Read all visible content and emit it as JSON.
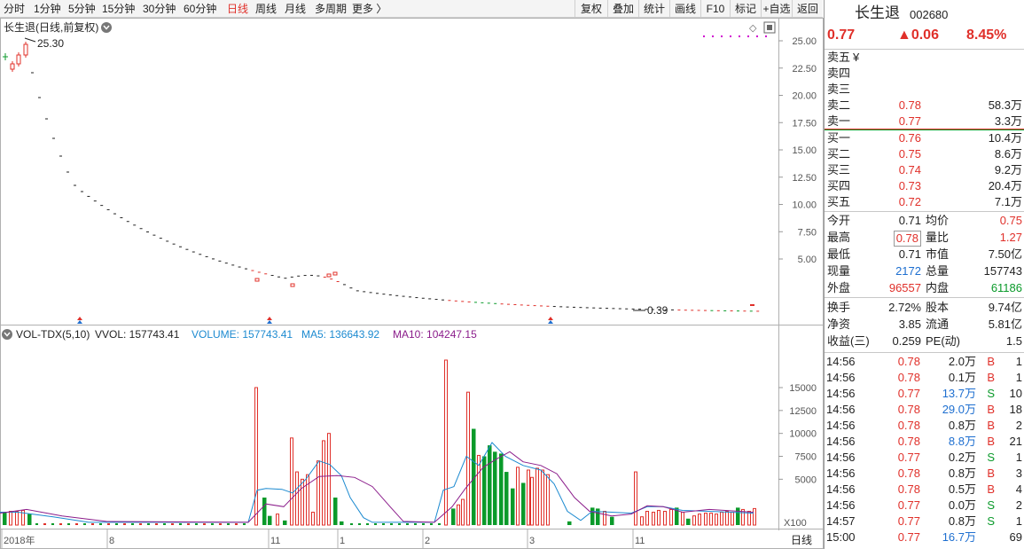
{
  "toolbar": {
    "periods": [
      {
        "label": "分时",
        "active": false
      },
      {
        "label": "1分钟",
        "active": false
      },
      {
        "label": "5分钟",
        "active": false
      },
      {
        "label": "15分钟",
        "active": false
      },
      {
        "label": "30分钟",
        "active": false
      },
      {
        "label": "60分钟",
        "active": false
      },
      {
        "label": "日线",
        "active": true
      },
      {
        "label": "周线",
        "active": false
      },
      {
        "label": "月线",
        "active": false
      },
      {
        "label": "多周期",
        "active": false
      },
      {
        "label": "更多 〉",
        "active": false
      }
    ],
    "tools": [
      "复权",
      "叠加",
      "统计",
      "画线",
      "F10",
      "标记",
      "+自选",
      "返回"
    ]
  },
  "price_chart": {
    "title": "长生退(日线,前复权)",
    "high_label": "25.30",
    "low_label": "0.39",
    "y_ticks": [
      "25.00",
      "22.50",
      "20.00",
      "17.50",
      "15.00",
      "12.50",
      "10.00",
      "7.50",
      "5.00"
    ]
  },
  "volume_chart": {
    "label_prefix": "VOL-TDX(5,10)",
    "vvol": "VVOL: 157743.41",
    "volume": "VOLUME: 157743.41",
    "ma5": "MA5: 136643.92",
    "ma10": "MA10: 104247.15",
    "y_ticks": [
      "15000",
      "12500",
      "10000",
      "7500",
      "5000"
    ],
    "unit": "X100"
  },
  "time_axis": {
    "labels": [
      "2018年",
      "8",
      "11",
      "1",
      "2",
      "3",
      "11"
    ],
    "period_label": "日线"
  },
  "colors": {
    "up": "#e0302a",
    "down": "#0a9a2a",
    "ma5": "#1c8ad0",
    "ma10": "#8b1d8b",
    "accent_pink": "#d000d0"
  },
  "quote": {
    "name": "长生退",
    "code": "002680",
    "price": "0.77",
    "change": "▲0.06",
    "change_pct": "8.45%",
    "asks": [
      {
        "label": "卖五",
        "price": "¥",
        "vol": ""
      },
      {
        "label": "卖四",
        "price": "",
        "vol": ""
      },
      {
        "label": "卖三",
        "price": "",
        "vol": ""
      },
      {
        "label": "卖二",
        "price": "0.78",
        "vol": "58.3万"
      },
      {
        "label": "卖一",
        "price": "0.77",
        "vol": "3.3万"
      }
    ],
    "bids": [
      {
        "label": "买一",
        "price": "0.76",
        "vol": "10.4万"
      },
      {
        "label": "买二",
        "price": "0.75",
        "vol": "8.6万"
      },
      {
        "label": "买三",
        "price": "0.74",
        "vol": "9.2万"
      },
      {
        "label": "买四",
        "price": "0.73",
        "vol": "20.4万"
      },
      {
        "label": "买五",
        "price": "0.72",
        "vol": "7.1万"
      }
    ],
    "stats": [
      {
        "l1": "今开",
        "v1": "0.71",
        "c1": "black",
        "l2": "均价",
        "v2": "0.75",
        "c2": "red"
      },
      {
        "l1": "最高",
        "v1": "0.78",
        "c1": "red",
        "l2": "量比",
        "v2": "1.27",
        "c2": "red"
      },
      {
        "l1": "最低",
        "v1": "0.71",
        "c1": "black",
        "l2": "市值",
        "v2": "7.50亿",
        "c2": "black"
      },
      {
        "l1": "现量",
        "v1": "2172",
        "c1": "blue",
        "l2": "总量",
        "v2": "157743",
        "c2": "black"
      },
      {
        "l1": "外盘",
        "v1": "96557",
        "c1": "red",
        "l2": "内盘",
        "v2": "61186",
        "c2": "green"
      }
    ],
    "stats2": [
      {
        "l1": "换手",
        "v1": "2.72%",
        "l2": "股本",
        "v2": "9.74亿"
      },
      {
        "l1": "净资",
        "v1": "3.85",
        "l2": "流通",
        "v2": "5.81亿"
      },
      {
        "l1": "收益(三)",
        "v1": "0.259",
        "l2": "PE(动)",
        "v2": "1.5"
      }
    ],
    "ticks": [
      {
        "t": "14:56",
        "p": "0.78",
        "v": "2.0万",
        "vc": "black",
        "bs": "B",
        "n": "1"
      },
      {
        "t": "14:56",
        "p": "0.78",
        "v": "0.1万",
        "vc": "black",
        "bs": "B",
        "n": "1"
      },
      {
        "t": "14:56",
        "p": "0.77",
        "v": "13.7万",
        "vc": "blue",
        "bs": "S",
        "n": "10"
      },
      {
        "t": "14:56",
        "p": "0.78",
        "v": "29.0万",
        "vc": "blue",
        "bs": "B",
        "n": "18"
      },
      {
        "t": "14:56",
        "p": "0.78",
        "v": "0.8万",
        "vc": "black",
        "bs": "B",
        "n": "2"
      },
      {
        "t": "14:56",
        "p": "0.78",
        "v": "8.8万",
        "vc": "blue",
        "bs": "B",
        "n": "21"
      },
      {
        "t": "14:56",
        "p": "0.77",
        "v": "0.2万",
        "vc": "black",
        "bs": "S",
        "n": "1"
      },
      {
        "t": "14:56",
        "p": "0.78",
        "v": "0.8万",
        "vc": "black",
        "bs": "B",
        "n": "3"
      },
      {
        "t": "14:56",
        "p": "0.78",
        "v": "0.5万",
        "vc": "black",
        "bs": "B",
        "n": "4"
      },
      {
        "t": "14:56",
        "p": "0.77",
        "v": "0.0万",
        "vc": "black",
        "bs": "S",
        "n": "2"
      },
      {
        "t": "14:57",
        "p": "0.77",
        "v": "0.8万",
        "vc": "black",
        "bs": "S",
        "n": "1"
      },
      {
        "t": "15:00",
        "p": "0.77",
        "v": "16.7万",
        "vc": "blue",
        "bs": "",
        "n": "69"
      }
    ]
  }
}
